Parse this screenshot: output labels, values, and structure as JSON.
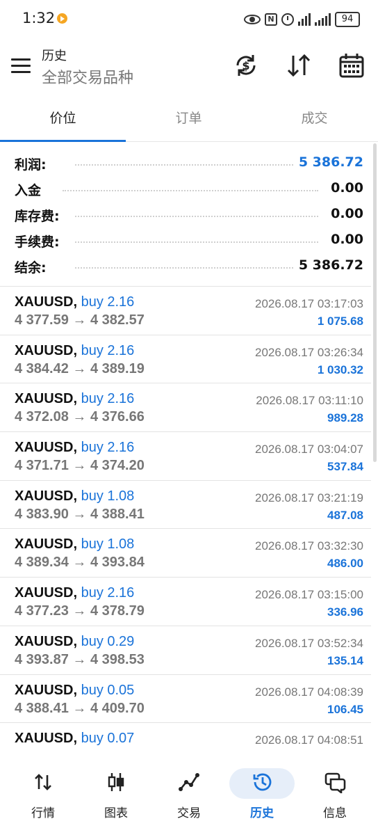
{
  "status_bar": {
    "time": "1:32",
    "battery": "94"
  },
  "header": {
    "title": "历史",
    "subtitle": "全部交易品种"
  },
  "tabs": [
    {
      "label": "价位"
    },
    {
      "label": "订单"
    },
    {
      "label": "成交"
    }
  ],
  "summary": [
    {
      "label": "利润:",
      "value": "5 386.72",
      "highlight": true
    },
    {
      "label": "入金",
      "value": "0.00",
      "highlight": false
    },
    {
      "label": "库存费:",
      "value": "0.00",
      "highlight": false
    },
    {
      "label": "手续费:",
      "value": "0.00",
      "highlight": false
    },
    {
      "label": "结余:",
      "value": "5 386.72",
      "highlight": false
    }
  ],
  "deals": [
    {
      "symbol": "XAUUSD,",
      "side": "buy 2.16",
      "prices": "4 377.59 → 4 382.57",
      "time": "2026.08.17 03:17:03",
      "profit": "1 075.68"
    },
    {
      "symbol": "XAUUSD,",
      "side": "buy 2.16",
      "prices": "4 384.42 → 4 389.19",
      "time": "2026.08.17 03:26:34",
      "profit": "1 030.32"
    },
    {
      "symbol": "XAUUSD,",
      "side": "buy 2.16",
      "prices": "4 372.08 → 4 376.66",
      "time": "2026.08.17 03:11:10",
      "profit": "989.28"
    },
    {
      "symbol": "XAUUSD,",
      "side": "buy 2.16",
      "prices": "4 371.71 → 4 374.20",
      "time": "2026.08.17 03:04:07",
      "profit": "537.84"
    },
    {
      "symbol": "XAUUSD,",
      "side": "buy 1.08",
      "prices": "4 383.90 → 4 388.41",
      "time": "2026.08.17 03:21:19",
      "profit": "487.08"
    },
    {
      "symbol": "XAUUSD,",
      "side": "buy 1.08",
      "prices": "4 389.34 → 4 393.84",
      "time": "2026.08.17 03:32:30",
      "profit": "486.00"
    },
    {
      "symbol": "XAUUSD,",
      "side": "buy 2.16",
      "prices": "4 377.23 → 4 378.79",
      "time": "2026.08.17 03:15:00",
      "profit": "336.96"
    },
    {
      "symbol": "XAUUSD,",
      "side": "buy 0.29",
      "prices": "4 393.87 → 4 398.53",
      "time": "2026.08.17 03:52:34",
      "profit": "135.14"
    },
    {
      "symbol": "XAUUSD,",
      "side": "buy 0.05",
      "prices": "4 388.41 → 4 409.70",
      "time": "2026.08.17 04:08:39",
      "profit": "106.45"
    },
    {
      "symbol": "XAUUSD,",
      "side": "buy 0.07",
      "prices": "",
      "time": "2026.08.17 04:08:51",
      "profit": ""
    }
  ],
  "bottom_nav": [
    {
      "label": "行情",
      "icon": "quotes-arrows-icon"
    },
    {
      "label": "图表",
      "icon": "candlestick-chart-icon"
    },
    {
      "label": "交易",
      "icon": "trade-line-icon"
    },
    {
      "label": "历史",
      "icon": "history-clock-icon",
      "active": true
    },
    {
      "label": "信息",
      "icon": "messages-chat-icon"
    }
  ],
  "colors": {
    "accent": "#1a73d9",
    "muted": "#777777"
  }
}
